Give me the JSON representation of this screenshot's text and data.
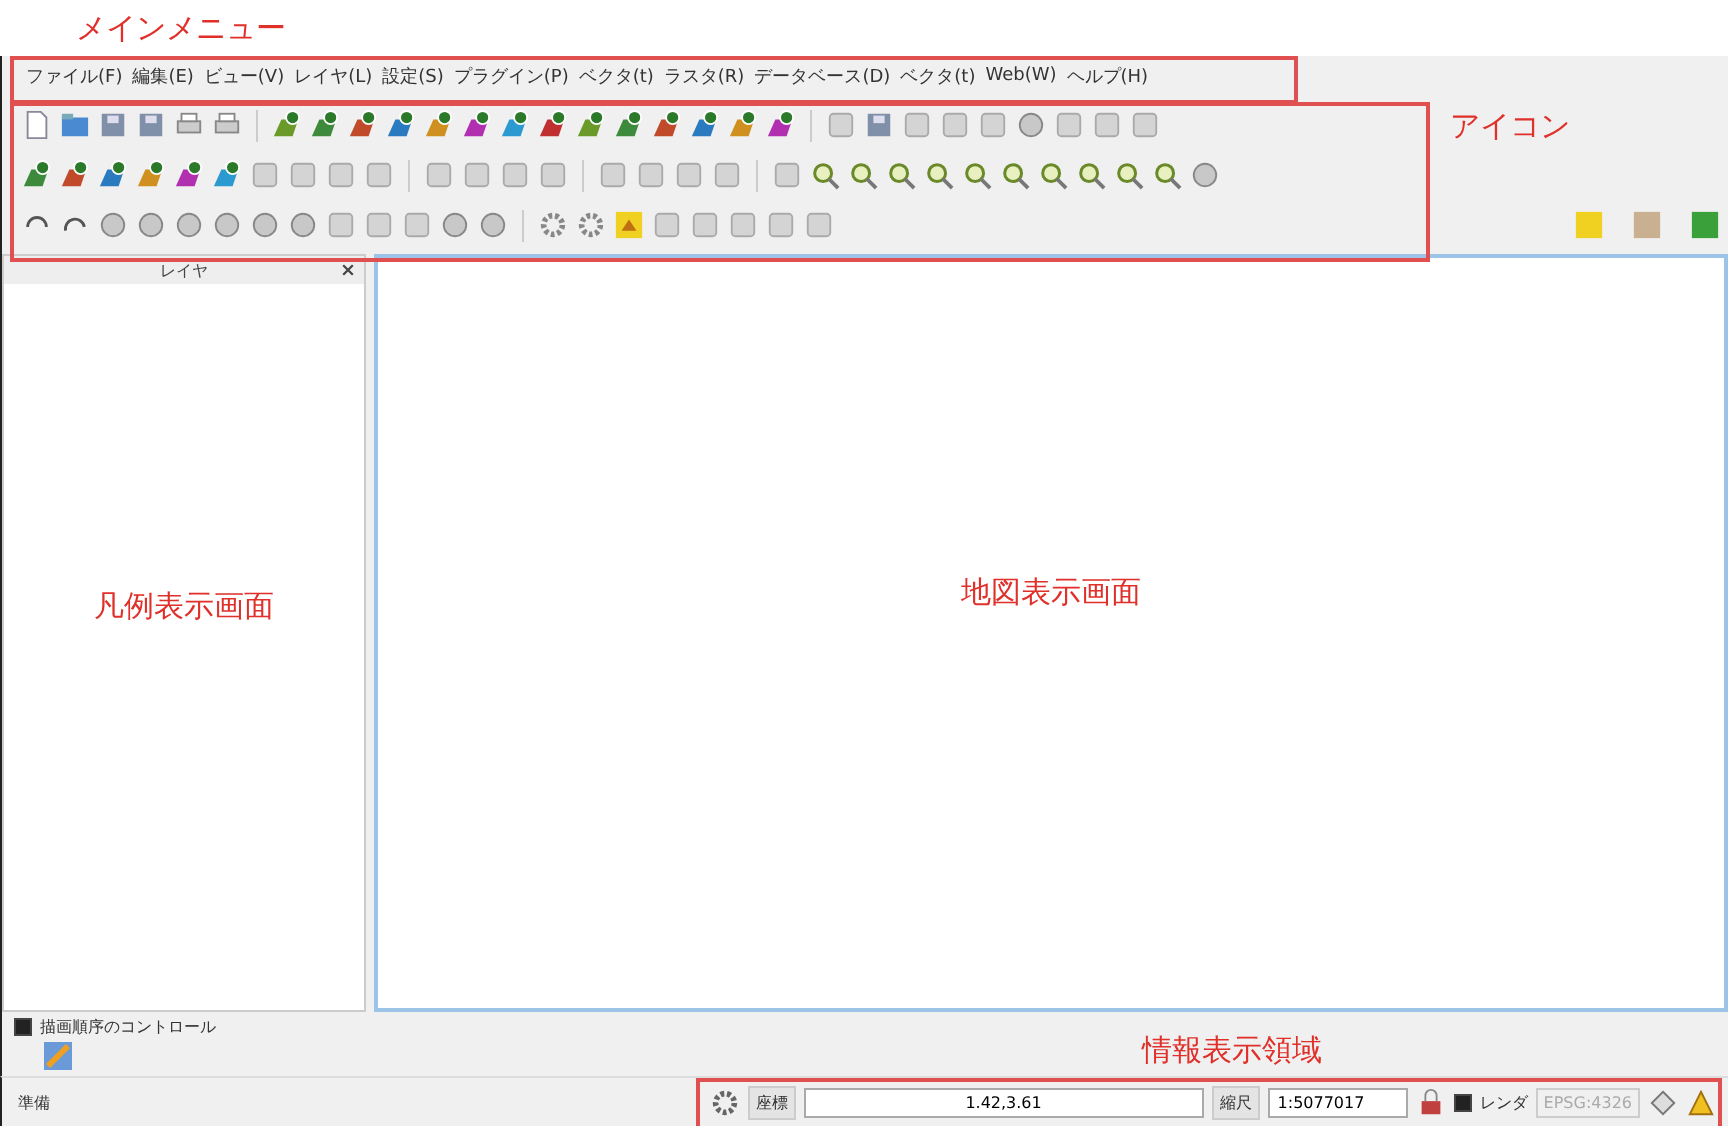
{
  "annotations": {
    "menu_label": "メインメニュー",
    "icons_label": "アイコン",
    "legend_label": "凡例表示画面",
    "map_label": "地図表示画面",
    "info_label": "情報表示領域"
  },
  "menu": [
    "ファイル(F)",
    "編集(E)",
    "ビュー(V)",
    "レイヤ(L)",
    "設定(S)",
    "プラグイン(P)",
    "ベクタ(t)",
    "ラスタ(R)",
    "データベース(D)",
    "ベクタ(t)",
    "Web(W)",
    "ヘルプ(H)"
  ],
  "layers_panel": {
    "title": "レイヤ"
  },
  "render_order": {
    "label": "描画順序のコントロール",
    "checked": true
  },
  "status_bar": {
    "ready": "準備",
    "coordinate_label": "座標",
    "coordinate": "1.42,3.61",
    "scale_label": "縮尺",
    "scale": "1:5077017",
    "render_label": "レンダ",
    "render_checked": true,
    "crs": "EPSG:4326"
  }
}
